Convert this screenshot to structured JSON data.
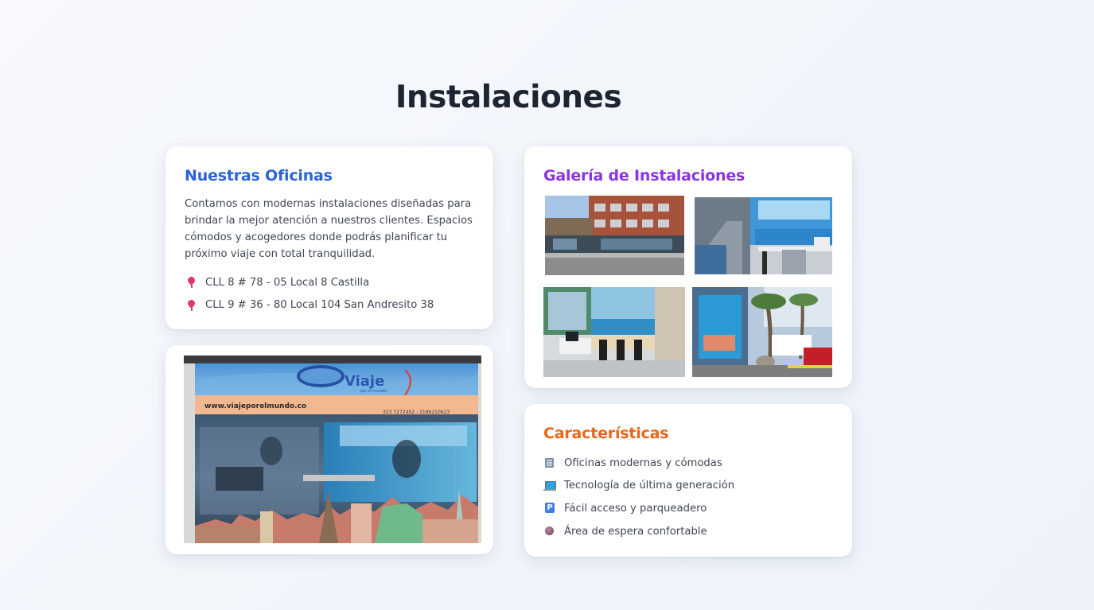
{
  "page": {
    "title": "Instalaciones"
  },
  "oficinas": {
    "heading": "Nuestras Oficinas",
    "description": "Contamos con modernas instalaciones diseñadas para brindar la mejor atención a nuestros clientes. Espacios cómodos y acogedores donde podrás planificar tu próximo viaje con total tranquilidad.",
    "addresses": [
      {
        "icon": "map-pin-icon",
        "text": "CLL 8 # 78 - 05 Local 8 Castilla"
      },
      {
        "icon": "map-pin-icon",
        "text": "CLL 9 # 36 - 80 Local 104 San Andresito 38"
      }
    ]
  },
  "storefront": {
    "sign_brand": "Viaje",
    "sign_subtitle": "por el mundo",
    "sign_url": "www.viajeporelmundo.co",
    "sign_phones": "323 7272452 - 3186210623"
  },
  "galeria": {
    "heading": "Galería de Instalaciones",
    "photos": [
      "building-exterior-photo",
      "office-interior-photo",
      "waiting-area-photo",
      "street-front-photo"
    ]
  },
  "caracteristicas": {
    "heading": "Características",
    "items": [
      {
        "icon": "building-icon",
        "text": "Oficinas modernas y cómodas"
      },
      {
        "icon": "laptop-icon",
        "text": "Tecnología de última generación"
      },
      {
        "icon": "parking-icon",
        "text": "Fácil acceso y parqueadero"
      },
      {
        "icon": "seat-icon",
        "text": "Área de espera confortable"
      }
    ]
  },
  "colors": {
    "title": "#1e2532",
    "oficinas_heading": "#2b63d9",
    "galeria_heading": "#8a34e0",
    "caracteristicas_heading": "#e8651a",
    "pin": "#e4356b"
  }
}
